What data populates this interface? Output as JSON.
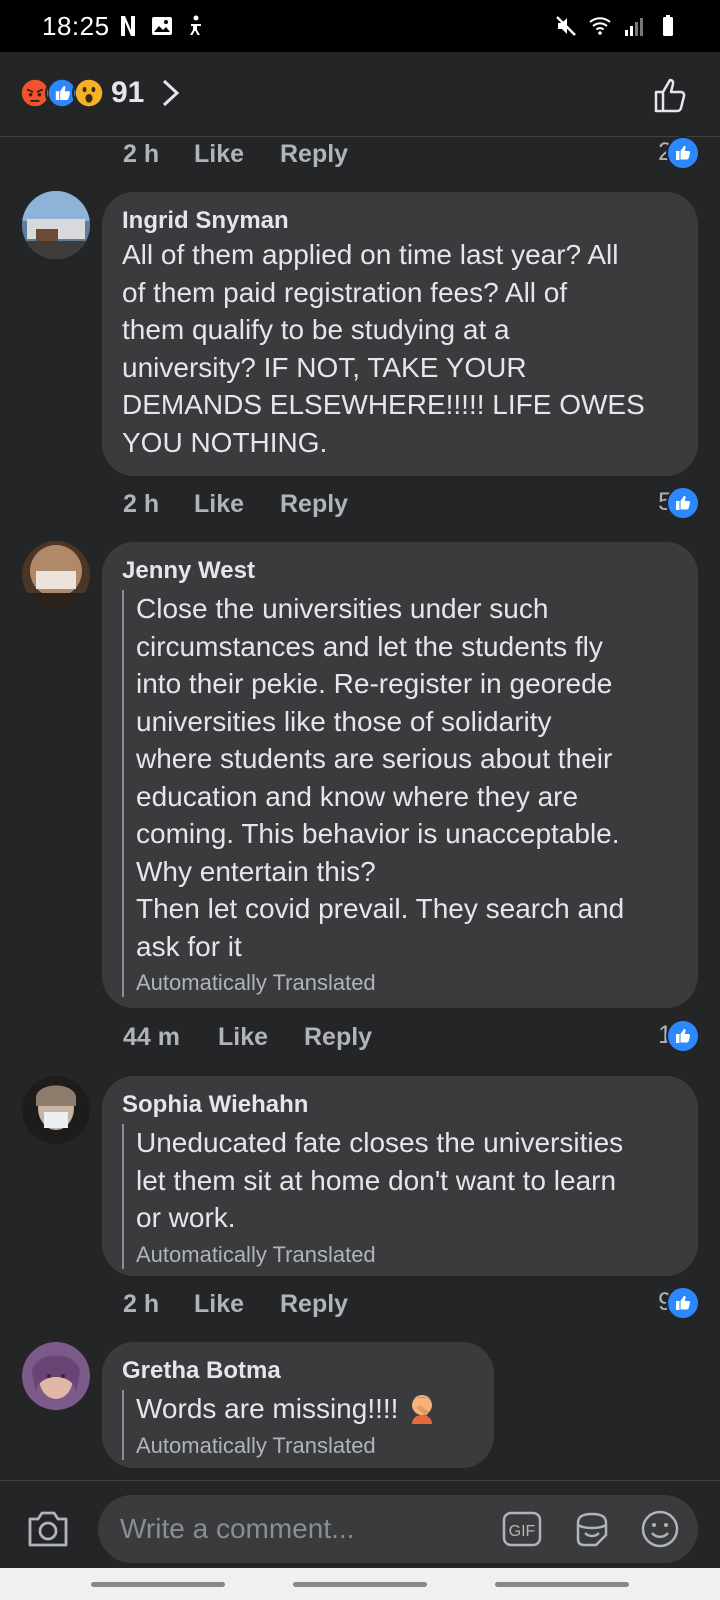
{
  "status_bar": {
    "time": "18:25"
  },
  "reactions": {
    "count": "91"
  },
  "top_meta": {
    "time": "2 h",
    "like_label": "Like",
    "reply_label": "Reply",
    "like_count": "2"
  },
  "comments": [
    {
      "author": "Ingrid Snyman",
      "text": "All of them applied on time last year? All\nof them paid registration fees? All of\nthem qualify to be studying at a\nuniversity? IF NOT, TAKE YOUR\nDEMANDS ELSEWHERE!!!!! LIFE OWES\nYOU NOTHING.",
      "time": "2 h",
      "like_label": "Like",
      "reply_label": "Reply",
      "like_count": "5"
    },
    {
      "author": "Jenny West",
      "text": "Close the universities under such\ncircumstances and let the students fly\ninto their pekie. Re-register in georede\nuniversities like those of solidarity\nwhere students are serious about their\neducation and know where they are\ncoming. This behavior is unacceptable.\nWhy entertain this?\nThen let covid prevail. They search and\nask for it",
      "translated_note": "Automatically Translated",
      "time": "44 m",
      "like_label": "Like",
      "reply_label": "Reply",
      "like_count": "1"
    },
    {
      "author": "Sophia Wiehahn",
      "text": "Uneducated fate closes the universities\nlet them sit at home don't want to learn\nor work.",
      "translated_note": "Automatically Translated",
      "time": "2 h",
      "like_label": "Like",
      "reply_label": "Reply",
      "like_count": "9"
    },
    {
      "author": "Gretha Botma",
      "text": "Words are missing!!!! ",
      "translated_note": "Automatically Translated"
    }
  ],
  "composer": {
    "placeholder": "Write a comment...",
    "gif_label": "GIF"
  },
  "colors": {
    "background": "#242526",
    "bubble": "#3a3b3c",
    "accent": "#2d88ff",
    "meta": "#b0b3b8"
  }
}
